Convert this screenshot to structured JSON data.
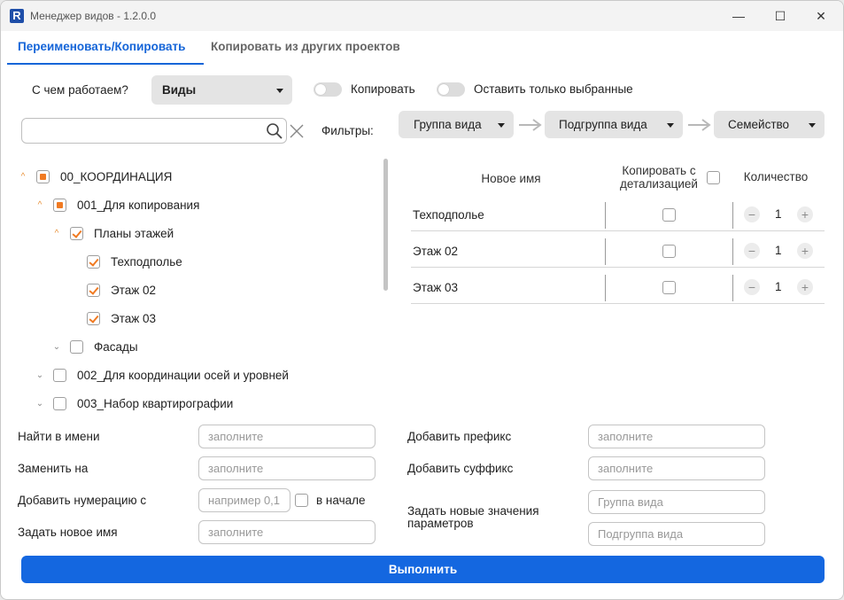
{
  "window": {
    "app_icon": "R",
    "title": "Менеджер видов - 1.2.0.0",
    "minimize_glyph": "—",
    "maximize_glyph": "☐",
    "close_glyph": "✕"
  },
  "tabs": [
    {
      "label": "Переименовать/Копировать",
      "active": true
    },
    {
      "label": "Копировать из других проектов",
      "active": false
    }
  ],
  "toolbar": {
    "work_with_label": "С чем работаем?",
    "work_with_value": "Виды",
    "copy_toggle_label": "Копировать",
    "keep_selected_toggle_label": "Оставить только выбранные"
  },
  "search": {
    "value": ""
  },
  "filters": {
    "label": "Фильтры:",
    "items": [
      "Группа вида",
      "Подгруппа вида",
      "Семейство"
    ]
  },
  "tree": [
    {
      "label": "00_КООРДИНАЦИЯ",
      "state": "partial",
      "expanded": true
    },
    {
      "label": "001_Для копирования",
      "state": "partial",
      "expanded": true
    },
    {
      "label": "Планы этажей",
      "state": "checked",
      "expanded": true
    },
    {
      "label": "Техподполье",
      "state": "checked"
    },
    {
      "label": "Этаж 02",
      "state": "checked"
    },
    {
      "label": "Этаж 03",
      "state": "checked"
    },
    {
      "label": "Фасады",
      "state": "unchecked",
      "expanded": false
    },
    {
      "label": "002_Для координации осей и уровней",
      "state": "unchecked",
      "expanded": false
    },
    {
      "label": "003_Набор квартирографии",
      "state": "unchecked",
      "expanded": false
    }
  ],
  "table": {
    "col_new_name": "Новое имя",
    "col_copy_detail_line1": "Копировать с",
    "col_copy_detail_line2": "детализацией",
    "col_quantity": "Количество",
    "rows": [
      {
        "name": "Техподполье",
        "copy_detail": false,
        "qty": "1"
      },
      {
        "name": "Этаж 02",
        "copy_detail": false,
        "qty": "1"
      },
      {
        "name": "Этаж 03",
        "copy_detail": false,
        "qty": "1"
      }
    ],
    "minus": "−",
    "plus": "+"
  },
  "form": {
    "find_label": "Найти в имени",
    "find_placeholder": "заполните",
    "replace_label": "Заменить на",
    "replace_placeholder": "заполните",
    "numbering_label": "Добавить нумерацию с",
    "numbering_placeholder": "например 0,1",
    "at_start_label": "в начале",
    "new_name_label": "Задать новое имя",
    "new_name_placeholder": "заполните",
    "prefix_label": "Добавить префикс",
    "prefix_placeholder": "заполните",
    "suffix_label": "Добавить суффикс",
    "suffix_placeholder": "заполните",
    "params_label_line1": "Задать новые значения",
    "params_label_line2": "параметров",
    "group_placeholder": "Группа вида",
    "subgroup_placeholder": "Подгруппа вида"
  },
  "run_button": "Выполнить",
  "colors": {
    "accent": "#1565d8",
    "check": "#f07a22",
    "run_button": "#1467e0"
  }
}
